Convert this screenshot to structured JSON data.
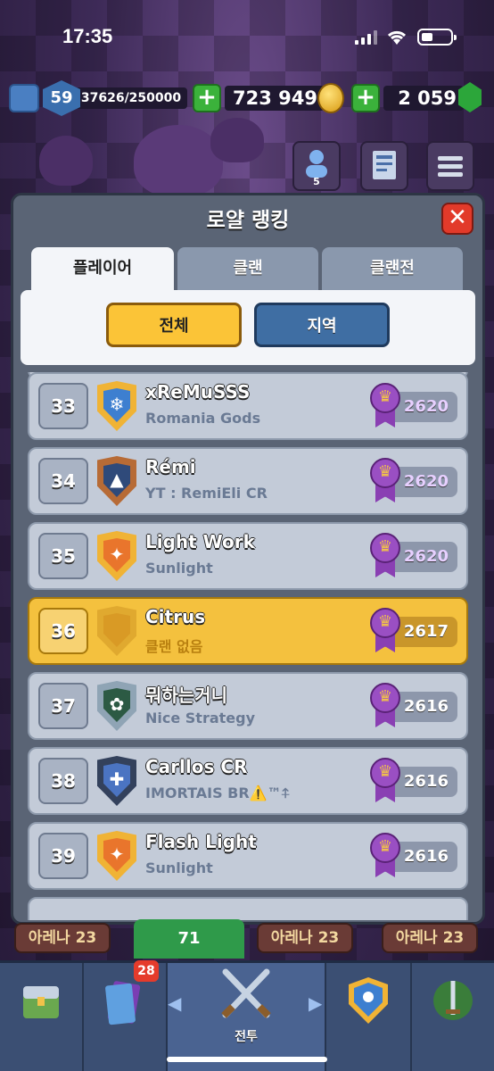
{
  "status_bar": {
    "time": "17:35"
  },
  "resources": {
    "level": "59",
    "xp": "37626/250000",
    "gold": "723 949",
    "gems": "2 059"
  },
  "friends_count": "5",
  "modal": {
    "title": "로얄 랭킹",
    "close": "✕",
    "tabs": [
      "플레이어",
      "클랜",
      "클랜전"
    ],
    "filters": {
      "all": "전체",
      "local": "지역"
    }
  },
  "rows": [
    {
      "rank": "33",
      "name": "xReMuSSS",
      "clan": "Romania Gods",
      "trophies": "2620",
      "badge_color": "#f0b335",
      "badge_inner": "#3d7fd0",
      "symbol": "❄"
    },
    {
      "rank": "34",
      "name": "Rémi",
      "clan": "YT : RemiEli CR",
      "trophies": "2620",
      "badge_color": "#b76b36",
      "badge_inner": "#2f4a7a",
      "symbol": "▲"
    },
    {
      "rank": "35",
      "name": "Light Work",
      "clan": "Sunlight",
      "trophies": "2620",
      "badge_color": "#f0b335",
      "badge_inner": "#e9752c",
      "symbol": "✦"
    },
    {
      "rank": "36",
      "name": "Citrus",
      "clan": "클랜 없음",
      "trophies": "2617",
      "badge_color": "#e0a92f",
      "badge_inner": "#d99a25",
      "symbol": ""
    },
    {
      "rank": "37",
      "name": "뭐하는거니",
      "clan": "Nice Strategy",
      "trophies": "2616",
      "badge_color": "#8fa4b5",
      "badge_inner": "#2c5a44",
      "symbol": "✿"
    },
    {
      "rank": "38",
      "name": "Carllos CR",
      "clan": "IMORTAIS BR⚠️™⍏",
      "trophies": "2616",
      "badge_color": "#33415c",
      "badge_inner": "#4b74c2",
      "symbol": "✚"
    },
    {
      "rank": "39",
      "name": "Flash Light",
      "clan": "Sunlight",
      "trophies": "2616",
      "badge_color": "#f0b335",
      "badge_inner": "#e9752c",
      "symbol": "✦"
    }
  ],
  "arena": {
    "left": "아레나 23",
    "middle": "71",
    "center": "아레나 23",
    "right": "아레나 23"
  },
  "bottom_nav": {
    "cards_badge": "28",
    "battle_label": "전투"
  }
}
